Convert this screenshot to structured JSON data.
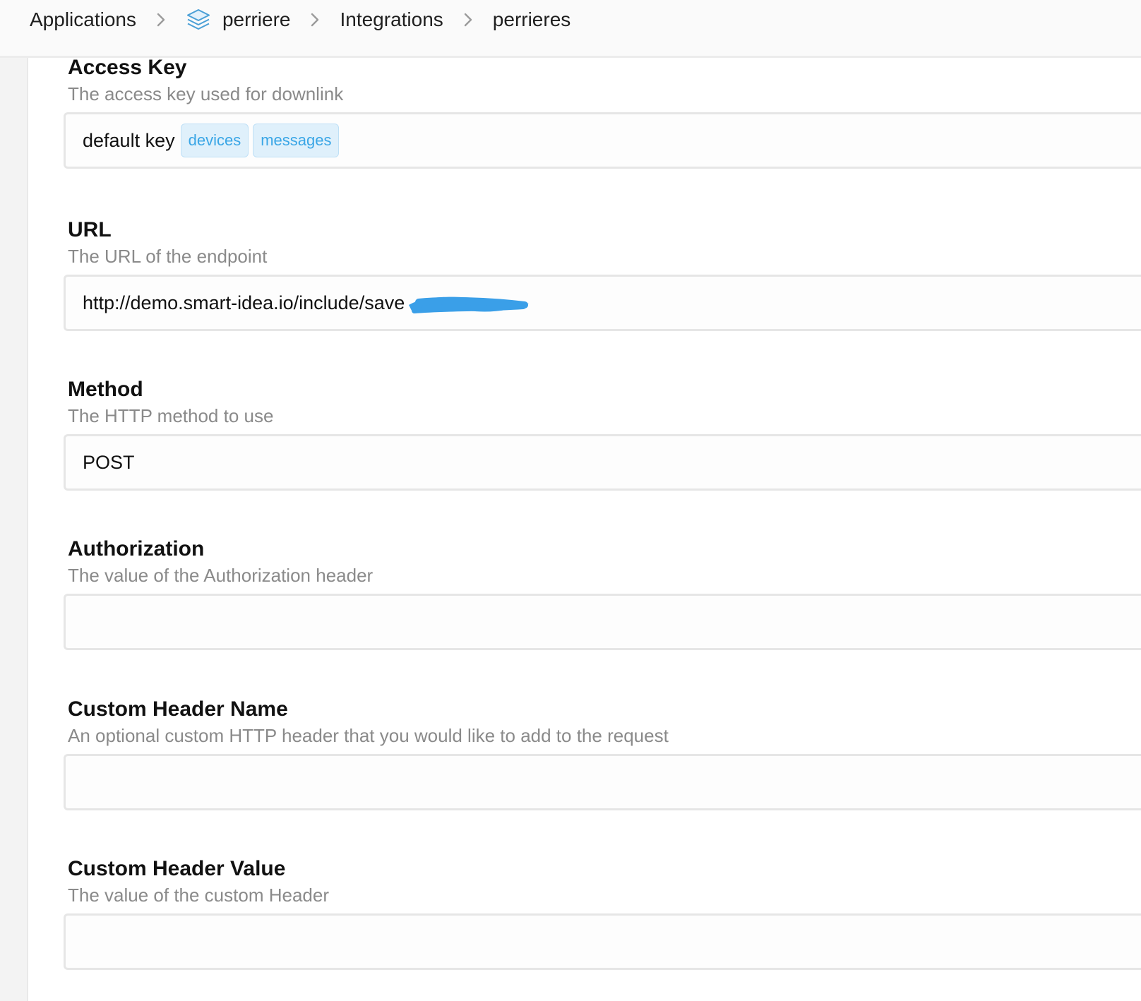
{
  "breadcrumb": {
    "items": [
      {
        "label": "Applications"
      },
      {
        "label": "perriere",
        "icon": "layers-icon"
      },
      {
        "label": "Integrations"
      },
      {
        "label": "perrieres"
      }
    ],
    "separator": ">"
  },
  "fields": {
    "access_key": {
      "label": "Access Key",
      "description": "The access key used for downlink",
      "value": "default key",
      "tags": [
        "devices",
        "messages"
      ]
    },
    "url": {
      "label": "URL",
      "description": "The URL of the endpoint",
      "value": "http://demo.smart-idea.io/include/save"
    },
    "method": {
      "label": "Method",
      "description": "The HTTP method to use",
      "value": "POST"
    },
    "authorization": {
      "label": "Authorization",
      "description": "The value of the Authorization header",
      "value": ""
    },
    "custom_header_name": {
      "label": "Custom Header Name",
      "description": "An optional custom HTTP header that you would like to add to the request",
      "value": ""
    },
    "custom_header_value": {
      "label": "Custom Header Value",
      "description": "The value of the custom Header",
      "value": ""
    }
  },
  "colors": {
    "tag_text": "#3aa6e6",
    "tag_bg": "#dff0fb",
    "redaction": "#3a9fe8"
  }
}
